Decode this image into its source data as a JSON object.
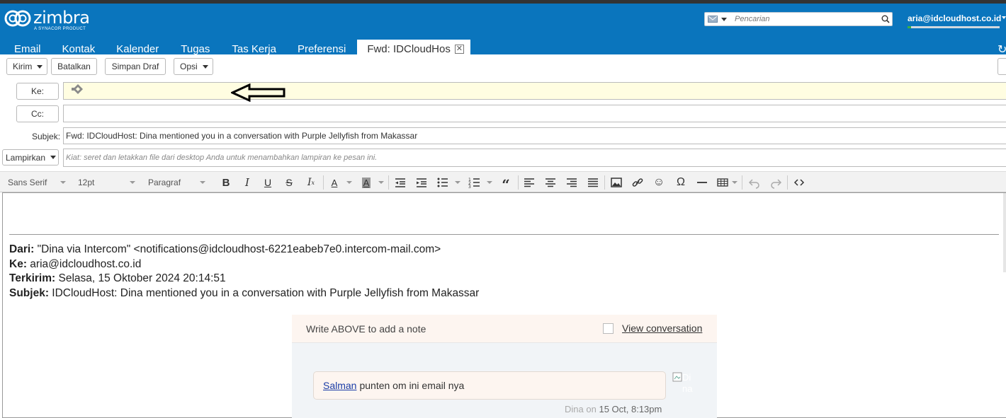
{
  "app": {
    "brand": "zimbra",
    "brand_sub": "A SYNACOR PRODUCT",
    "search_placeholder": "Pencarian",
    "user": "aria@idcloudhost.co.id",
    "quota_fraction": 0.04
  },
  "tabs": [
    {
      "label": "Email"
    },
    {
      "label": "Kontak"
    },
    {
      "label": "Kalender"
    },
    {
      "label": "Tugas"
    },
    {
      "label": "Tas Kerja"
    },
    {
      "label": "Preferensi"
    },
    {
      "label": "Fwd: IDCloudHos",
      "active": true
    }
  ],
  "toolbar": {
    "send": "Kirim",
    "cancel": "Batalkan",
    "save_draft": "Simpan Draf",
    "options": "Opsi"
  },
  "compose": {
    "to_label": "Ke:",
    "cc_label": "Cc:",
    "subject_label": "Subjek:",
    "subject_value": "Fwd: IDCloudHost: Dina mentioned you in a conversation with Purple Jellyfish from Makassar",
    "attach_label": "Lampirkan",
    "attach_hint": "Kiat: seret dan letakkan file dari desktop Anda untuk menambahkan lampiran ke pesan ini."
  },
  "editor_toolbar": {
    "font_family": "Sans Serif",
    "font_size": "12pt",
    "paragraph": "Paragraf",
    "icons": [
      "bold-icon",
      "italic-icon",
      "underline-icon",
      "strikethrough-icon",
      "clear-format-icon",
      "text-color-icon",
      "highlight-color-icon",
      "outdent-icon",
      "indent-icon",
      "bullet-list-icon",
      "numbered-list-icon",
      "blockquote-icon",
      "align-left-icon",
      "align-center-icon",
      "align-right-icon",
      "justify-icon",
      "image-icon",
      "link-icon",
      "emoji-icon",
      "special-char-icon",
      "horizontal-rule-icon",
      "table-icon",
      "undo-icon",
      "redo-icon",
      "source-code-icon"
    ]
  },
  "forwarded": {
    "from_label": "Dari:",
    "from_value": "\"Dina via Intercom\" <notifications@idcloudhost-6221eabeb7e0.intercom-mail.com>",
    "to_label": "Ke:",
    "to_value": "aria@idcloudhost.co.id",
    "sent_label": "Terkirim:",
    "sent_value": "Selasa, 15 Oktober 2024 20:14:51",
    "subject_label": "Subjek:",
    "subject_value": "IDCloudHost: Dina mentioned you in a conversation with Purple Jellyfish from Makassar"
  },
  "intercom": {
    "write_above": "Write ABOVE to add a note",
    "view_conversation": "View conversation",
    "mention": "Salman",
    "note_text": "punten om ini email nya",
    "avatar_alt_1": "Di",
    "avatar_alt_2": "na",
    "author": "Dina",
    "on": "on",
    "time": "15 Oct, 8:13pm"
  },
  "colors": {
    "header_blue": "#0a75bd",
    "to_field_bg": "#fffde1",
    "note_bg": "#fdf5f0",
    "card_bg": "#f1f4f7",
    "link": "#1a3ca6"
  }
}
